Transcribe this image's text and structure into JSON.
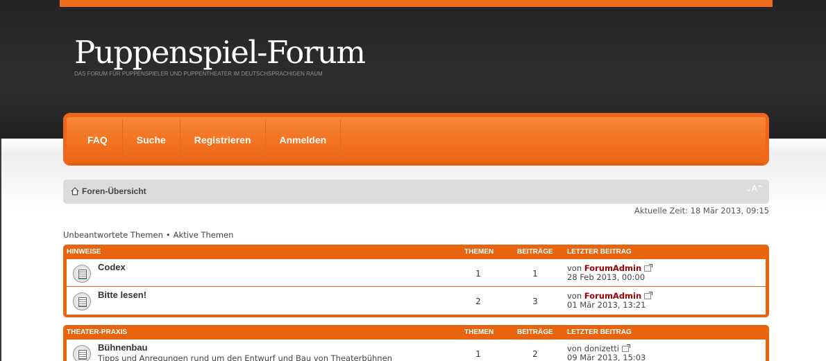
{
  "header": {
    "site_title": "Puppenspiel-Forum",
    "site_description": "DAS FORUM FÜR PUPPENSPIELER UND PUPPENTHEATER IM DEUTSCHSPRACHIGEN RAUM"
  },
  "nav": {
    "items": [
      {
        "label": "FAQ"
      },
      {
        "label": "Suche"
      },
      {
        "label": "Registrieren"
      },
      {
        "label": "Anmelden"
      }
    ]
  },
  "breadcrumb": {
    "label": "Foren-Übersicht",
    "home_icon": "home-icon",
    "font_size_control": "⌄A⌃"
  },
  "current_time": "Aktuelle Zeit: 18 Mär 2013, 09:15",
  "quick_links": {
    "unanswered": "Unbeantwortete Themen",
    "separator": "•",
    "active": "Aktive Themen"
  },
  "categories": [
    {
      "name": "HINWEISE",
      "col_topics": "THEMEN",
      "col_posts": "BEITRÄGE",
      "col_last": "LETZTER BEITRAG",
      "forums": [
        {
          "title": "Codex",
          "description": "",
          "topics": "1",
          "posts": "1",
          "last_prefix": "von",
          "last_author": "ForumAdmin",
          "last_date": "28 Feb 2013, 00:00"
        },
        {
          "title": "Bitte lesen!",
          "description": "",
          "topics": "2",
          "posts": "3",
          "last_prefix": "von",
          "last_author": "ForumAdmin",
          "last_date": "01 Mär 2013, 13:21"
        }
      ]
    },
    {
      "name": "THEATER-PRAXIS",
      "col_topics": "THEMEN",
      "col_posts": "BEITRÄGE",
      "col_last": "LETZTER BEITRAG",
      "forums": [
        {
          "title": "Bühnenbau",
          "description": "Tipps und Anregungen rund um den Entwurf und Bau von Theaterbühnen",
          "topics": "1",
          "posts": "2",
          "last_prefix": "von",
          "last_author": "donizetti",
          "last_date": "09 Mär 2013, 15:03"
        }
      ]
    }
  ],
  "colors": {
    "accent": "#ee6d1d",
    "header_bg": "#262626",
    "author_link": "#a00000"
  }
}
